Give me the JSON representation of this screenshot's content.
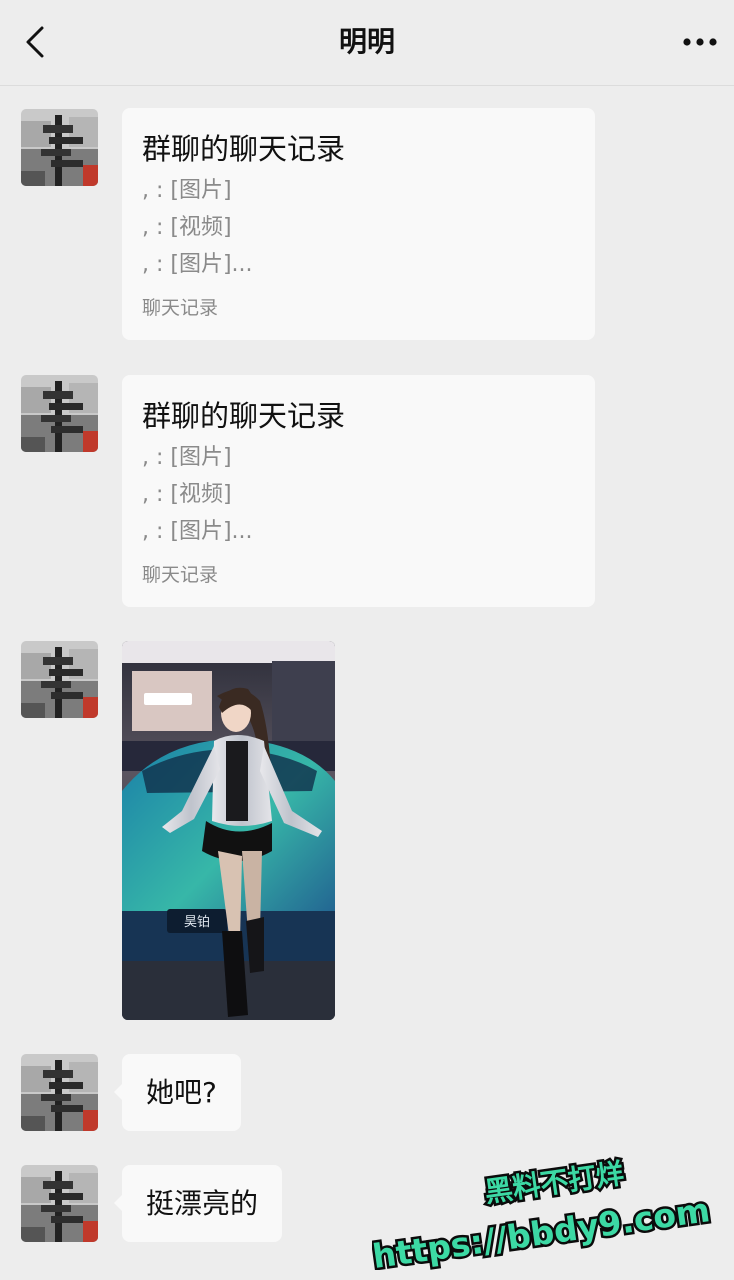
{
  "header": {
    "title": "明明",
    "back_icon": "chevron-left-icon",
    "more_icon": "more-dots-icon"
  },
  "messages": [
    {
      "type": "chat_record",
      "title": "群聊的聊天记录",
      "lines": [
        ", : [图片]",
        ", : [视频]",
        ", : [图片]..."
      ],
      "footer": "聊天记录"
    },
    {
      "type": "chat_record",
      "title": "群聊的聊天记录",
      "lines": [
        ", : [图片]",
        ", : [视频]",
        ", : [图片]..."
      ],
      "footer": "聊天记录"
    },
    {
      "type": "image",
      "car_badge": "昊铂"
    },
    {
      "type": "text",
      "text": "她吧?"
    },
    {
      "type": "text",
      "text": "挺漂亮的"
    }
  ],
  "watermark": {
    "line1": "黑料不打烊",
    "line2": "https://bbdy9.com",
    "color": "#3cd9a4"
  },
  "colors": {
    "background": "#ededed",
    "bubble": "#f9f9f9",
    "secondary_text": "#8a8a8a"
  }
}
